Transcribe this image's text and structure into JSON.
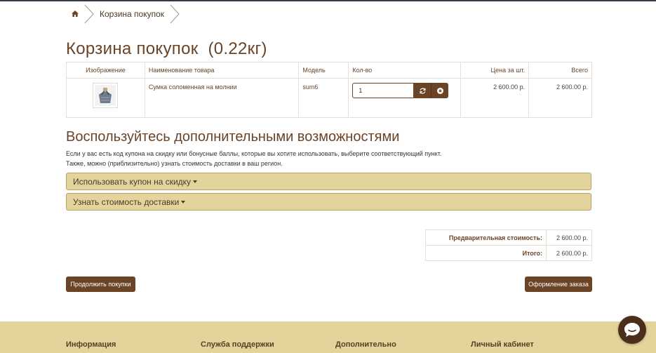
{
  "breadcrumb": {
    "home_icon": "home-icon",
    "items": [
      {
        "label": "Корзина покупок"
      }
    ]
  },
  "page": {
    "title": "Корзина покупок  (0.22кг)"
  },
  "cart": {
    "columns": {
      "image": "Изображение",
      "name": "Наименование товара",
      "model": "Модель",
      "qty": "Кол-во",
      "price": "Цена за шт.",
      "total": "Всего"
    },
    "rows": [
      {
        "name": "Сумка соломенная на молнии",
        "model": "sum6",
        "qty": "1",
        "price": "2 600.00 р.",
        "total": "2 600.00 р.",
        "update_icon": "refresh-icon",
        "remove_icon": "times-circle-icon"
      }
    ]
  },
  "extra": {
    "title": "Воспользуйтесь дополнительными возможностями",
    "line1": "Если у вас есть код купона на скидку или бонусные баллы, которые вы хотите использовать, выберите соответствующий пункт.",
    "line2": "Также, можно (приблизительно) узнать стоимость доставки в ваш регион.",
    "panels": [
      {
        "label": "Использовать купон на скидку"
      },
      {
        "label": "Узнать стоимость доставки"
      }
    ]
  },
  "totals": [
    {
      "label": "Предварительная стоимость:",
      "value": "2 600.00 р."
    },
    {
      "label": "Итого:",
      "value": "2 600.00 р."
    }
  ],
  "buttons": {
    "continue": "Продолжить покупки",
    "checkout": "Оформление заказа"
  },
  "footer": {
    "columns": [
      "Информация",
      "Служба поддержки",
      "Дополнительно",
      "Личный кабинет"
    ]
  },
  "colors": {
    "accent": "#6b4427",
    "panel": "#e3d49c",
    "footer": "#e3d49c"
  }
}
